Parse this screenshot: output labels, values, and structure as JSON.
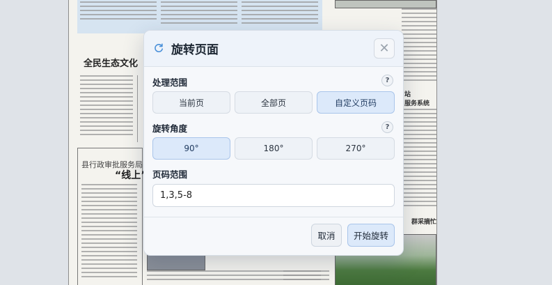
{
  "dialog": {
    "title": "旋转页面",
    "close_symbol": "✕",
    "scope": {
      "label": "处理范围",
      "help_symbol": "?",
      "options": [
        "当前页",
        "全部页",
        "自定义页码"
      ],
      "selected": "自定义页码"
    },
    "angle": {
      "label": "旋转角度",
      "help_symbol": "?",
      "options": [
        "90°",
        "180°",
        "270°"
      ],
      "selected": "90°"
    },
    "page_range": {
      "label": "页码范围",
      "value": "1,3,5-8"
    },
    "buttons": {
      "cancel": "取消",
      "start": "开始旋转"
    }
  },
  "background_document": {
    "headlines": {
      "ecology": "全民生态文化",
      "county": "县行政审批服务局",
      "online": "“线上”",
      "station": "站",
      "system": "服务系统",
      "help": "群采摘忙"
    }
  },
  "icons": {
    "title_icon": "refresh-icon",
    "close_icon": "close-icon",
    "help_icon": "question-icon"
  },
  "colors": {
    "accent": "#4a90d9",
    "selected_bg": "#dce9fa",
    "selected_border": "#a9c5ea"
  }
}
